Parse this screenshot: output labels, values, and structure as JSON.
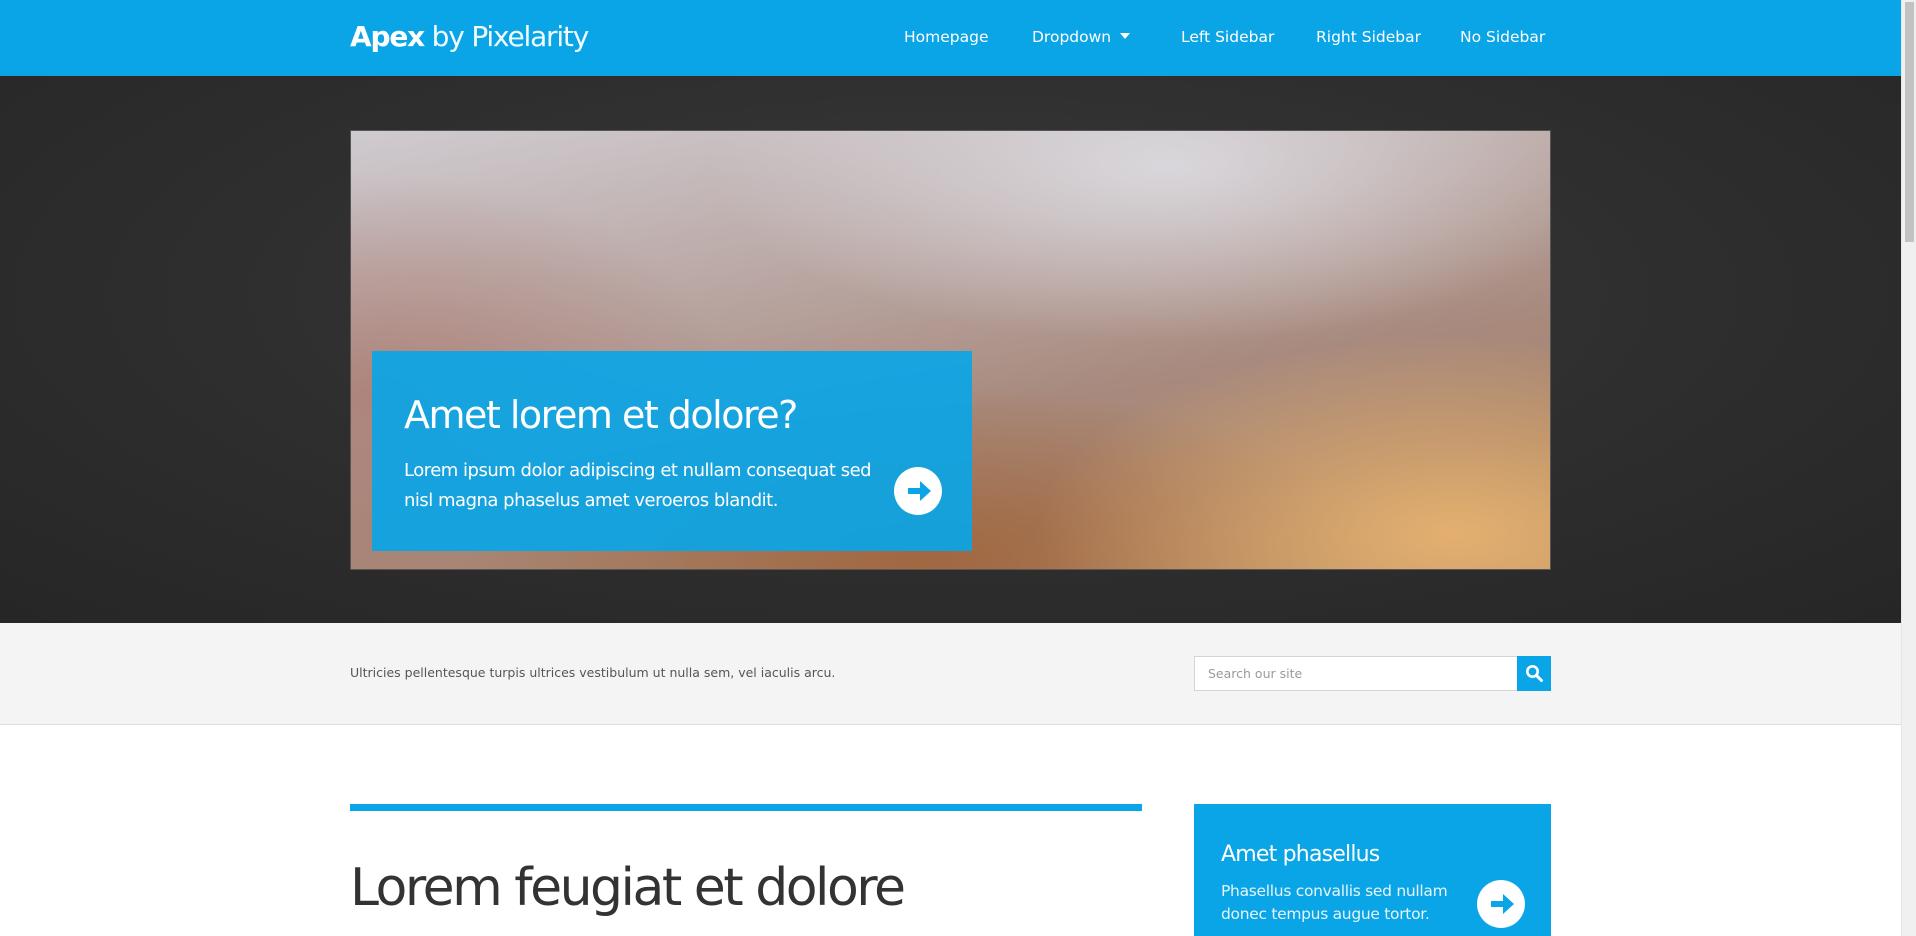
{
  "header": {
    "logo_strong": "Apex",
    "logo_light": " by Pixelarity",
    "nav": [
      {
        "label": "Homepage"
      },
      {
        "label": "Dropdown"
      },
      {
        "label": "Left Sidebar"
      },
      {
        "label": "Right Sidebar"
      },
      {
        "label": "No Sidebar"
      }
    ]
  },
  "banner": {
    "caption_title": "Amet lorem et dolore?",
    "caption_text": "Lorem ipsum dolor adipiscing et nullam consequat sed nisl magna phaselus amet veroeros blandit."
  },
  "intro": {
    "text": "Ultricies pellentesque turpis ultrices vestibulum ut nulla sem, vel iaculis arcu.",
    "search_placeholder": "Search our site"
  },
  "main": {
    "heading": "Lorem feugiat et dolore"
  },
  "sidebar": {
    "title": "Amet phasellus",
    "text": "Phasellus convallis sed nullam donec tempus augue tortor."
  },
  "colors": {
    "accent": "#0aa5e6",
    "banner_bg": "#2e2e2e",
    "strip_bg": "#f4f4f4"
  },
  "icons": [
    "chevron-down-icon",
    "arrow-right-icon",
    "search-icon"
  ]
}
